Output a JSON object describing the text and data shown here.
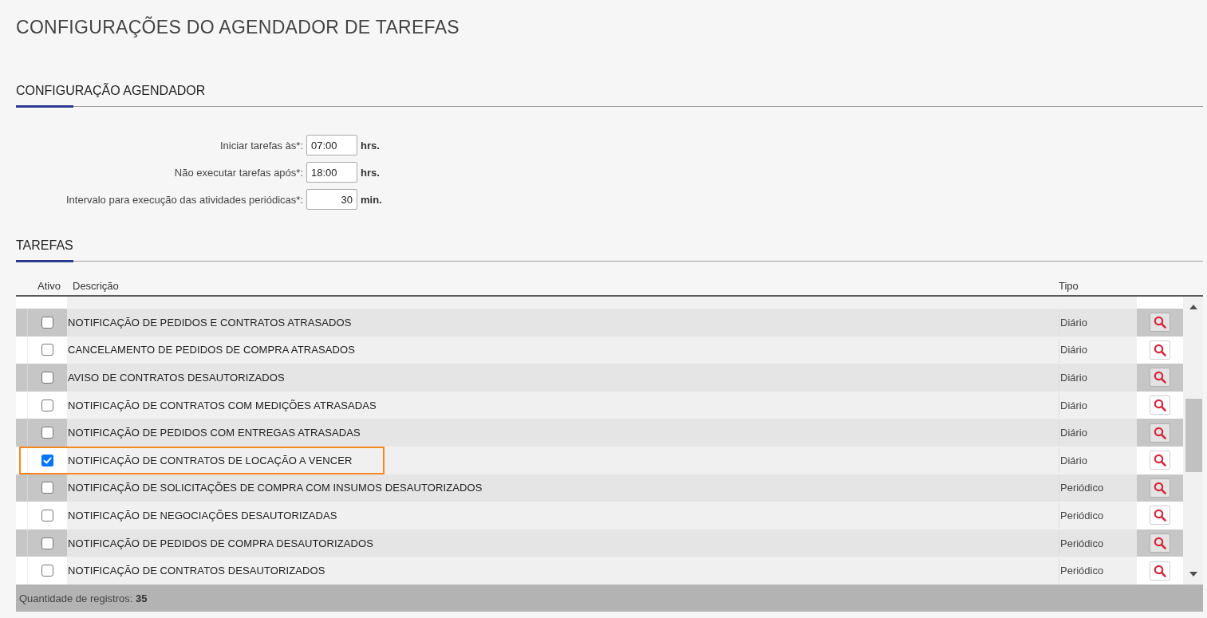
{
  "page_title": "CONFIGURAÇÕES DO AGENDADOR DE TAREFAS",
  "scheduler": {
    "heading": "CONFIGURAÇÃO AGENDADOR",
    "fields": [
      {
        "kind": "time",
        "label": "Iniciar tarefas às*:",
        "value": "07:00",
        "unit": "hrs."
      },
      {
        "kind": "time",
        "label": "Não executar tarefas após*:",
        "value": "18:00",
        "unit": "hrs."
      },
      {
        "kind": "number",
        "label": "Intervalo para execução das atividades periódicas*:",
        "value": "30",
        "unit": "min."
      }
    ]
  },
  "tasks": {
    "heading": "TAREFAS",
    "columns": [
      "Ativo",
      "Descrição",
      "Tipo"
    ],
    "rows": [
      {
        "checked": false,
        "highlighted": false,
        "description": "NOTIFICAÇÃO DE PEDIDOS E CONTRATOS ATRASADOS",
        "type": "Diário"
      },
      {
        "checked": false,
        "highlighted": false,
        "description": "CANCELAMENTO DE PEDIDOS DE COMPRA ATRASADOS",
        "type": "Diário"
      },
      {
        "checked": false,
        "highlighted": false,
        "description": "AVISO DE CONTRATOS DESAUTORIZADOS",
        "type": "Diário"
      },
      {
        "checked": false,
        "highlighted": false,
        "description": "NOTIFICAÇÃO DE CONTRATOS COM MEDIÇÕES ATRASADAS",
        "type": "Diário"
      },
      {
        "checked": false,
        "highlighted": false,
        "description": "NOTIFICAÇÃO DE PEDIDOS COM ENTREGAS ATRASADAS",
        "type": "Diário"
      },
      {
        "checked": true,
        "highlighted": true,
        "description": "NOTIFICAÇÃO DE CONTRATOS DE LOCAÇÃO A VENCER",
        "type": "Diário"
      },
      {
        "checked": false,
        "highlighted": false,
        "description": "NOTIFICAÇÃO DE SOLICITAÇÕES DE COMPRA COM INSUMOS DESAUTORIZADOS",
        "type": "Periódico"
      },
      {
        "checked": false,
        "highlighted": false,
        "description": "NOTIFICAÇÃO DE NEGOCIAÇÕES DESAUTORIZADAS",
        "type": "Periódico"
      },
      {
        "checked": false,
        "highlighted": false,
        "description": "NOTIFICAÇÃO DE PEDIDOS DE COMPRA DESAUTORIZADOS",
        "type": "Periódico"
      },
      {
        "checked": false,
        "highlighted": false,
        "description": "NOTIFICAÇÃO DE CONTRATOS DESAUTORIZADOS",
        "type": "Periódico"
      }
    ],
    "footer": "Quantidade de registros: **35**"
  }
}
